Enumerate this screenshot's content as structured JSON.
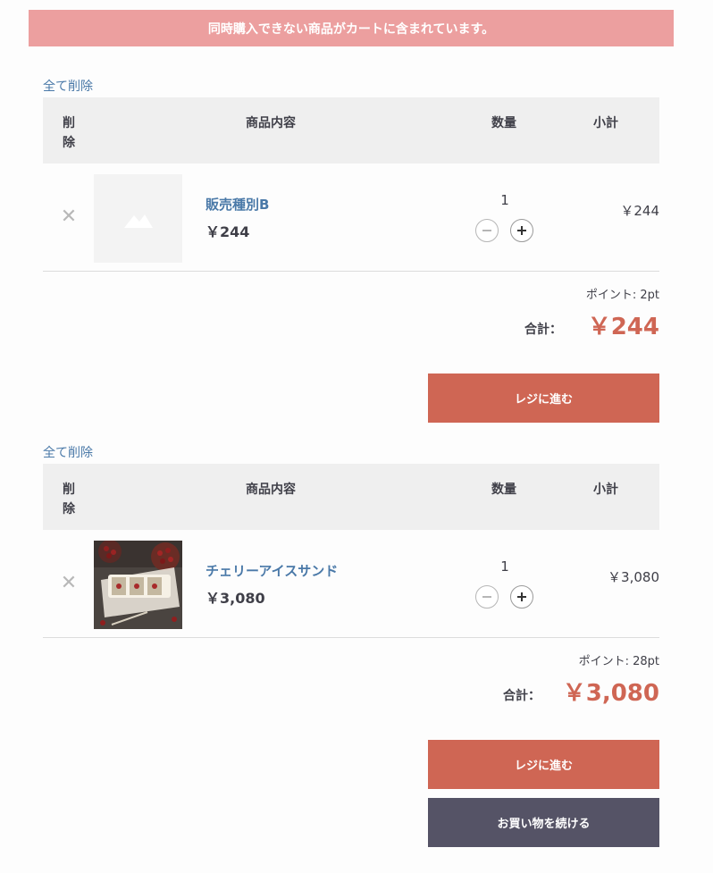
{
  "alert": {
    "message": "同時購入できない商品がカートに含まれています。"
  },
  "table_headers": {
    "delete": "削除",
    "item": "商品内容",
    "quantity": "数量",
    "subtotal": "小計"
  },
  "carts": [
    {
      "delete_all_label": "全て削除",
      "item": {
        "name": "販売種別B",
        "price": "￥244",
        "quantity": "1",
        "subtotal": "￥244",
        "image": "placeholder-icon"
      },
      "points": "ポイント: 2pt",
      "total_label": "合計：",
      "total_value": "￥244",
      "checkout_label": "レジに進む"
    },
    {
      "delete_all_label": "全て削除",
      "item": {
        "name": "チェリーアイスサンド",
        "price": "￥3,080",
        "quantity": "1",
        "subtotal": "￥3,080",
        "image": "cherry-ice-sandwich-photo"
      },
      "points": "ポイント: 28pt",
      "total_label": "合計：",
      "total_value": "￥3,080",
      "checkout_label": "レジに進む"
    }
  ],
  "continue_shopping_label": "お買い物を続ける",
  "colors": {
    "alert_bg": "#ec9f9f",
    "link": "#4a79a8",
    "accent": "#cf6654",
    "dark_button": "#555366"
  }
}
